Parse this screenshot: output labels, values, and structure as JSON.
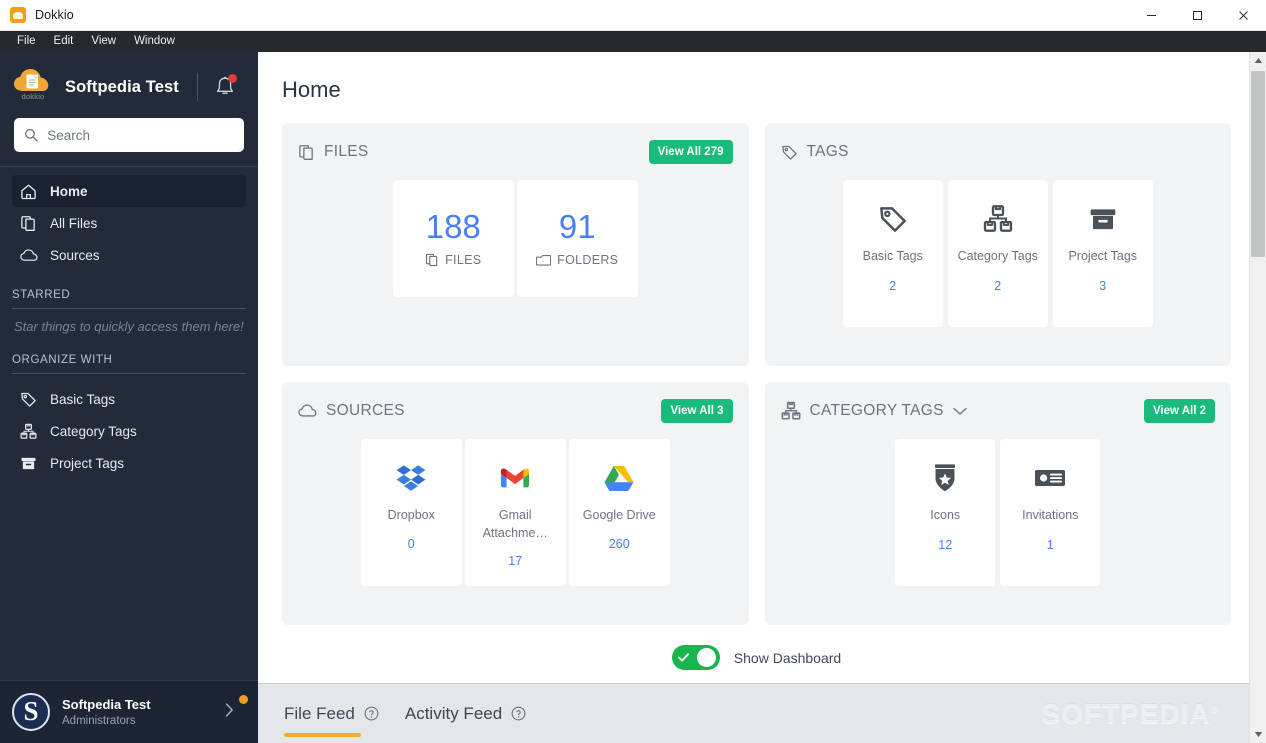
{
  "window": {
    "title": "Dokkio",
    "app_icon": "dokkio-cloud-icon",
    "controls": {
      "minimize": "minimize-icon",
      "maximize": "maximize-icon",
      "close": "close-icon"
    }
  },
  "menubar": {
    "items": [
      "File",
      "Edit",
      "View",
      "Window"
    ]
  },
  "sidebar": {
    "logo_text": "dokkio",
    "account_name": "Softpedia Test",
    "bell": {
      "icon": "bell-icon",
      "has_notification": true
    },
    "search": {
      "placeholder": "Search",
      "value": ""
    },
    "nav": [
      {
        "label": "Home",
        "icon": "home-icon",
        "active": true
      },
      {
        "label": "All Files",
        "icon": "files-icon",
        "active": false
      },
      {
        "label": "Sources",
        "icon": "cloud-icon",
        "active": false
      }
    ],
    "starred": {
      "heading": "STARRED",
      "empty_text": "Star things to quickly access them here!"
    },
    "organize": {
      "heading": "ORGANIZE WITH",
      "items": [
        {
          "label": "Basic Tags",
          "icon": "tag-icon"
        },
        {
          "label": "Category Tags",
          "icon": "category-tags-icon"
        },
        {
          "label": "Project Tags",
          "icon": "archive-box-icon"
        }
      ]
    },
    "user": {
      "avatar_letter": "S",
      "name": "Softpedia Test",
      "role": "Administrators",
      "chevron": "chevron-right-icon",
      "status_dot": true
    }
  },
  "main": {
    "page_title": "Home",
    "cards": {
      "files": {
        "title": "FILES",
        "icon": "files-icon",
        "view_all_label": "View All 279",
        "tiles": [
          {
            "value": "188",
            "label": "FILES",
            "icon": "files-icon"
          },
          {
            "value": "91",
            "label": "FOLDERS",
            "icon": "folder-icon"
          }
        ]
      },
      "tags": {
        "title": "TAGS",
        "icon": "tag-icon",
        "tiles": [
          {
            "name": "Basic Tags",
            "count": "2",
            "icon": "tag-icon"
          },
          {
            "name": "Category Tags",
            "count": "2",
            "icon": "category-tags-icon"
          },
          {
            "name": "Project Tags",
            "count": "3",
            "icon": "archive-box-icon"
          }
        ]
      },
      "sources": {
        "title": "SOURCES",
        "icon": "cloud-icon",
        "view_all_label": "View All 3",
        "tiles": [
          {
            "name": "Dropbox",
            "count": "0",
            "icon": "dropbox-icon"
          },
          {
            "name": "Gmail Attachme…",
            "count": "17",
            "icon": "gmail-icon"
          },
          {
            "name": "Google Drive",
            "count": "260",
            "icon": "google-drive-icon"
          }
        ]
      },
      "category_tags": {
        "title": "CATEGORY TAGS",
        "icon": "category-tags-icon",
        "chevron": "chevron-down-icon",
        "view_all_label": "View All 2",
        "tiles": [
          {
            "name": "Icons",
            "count": "12",
            "icon": "shield-star-icon"
          },
          {
            "name": "Invitations",
            "count": "1",
            "icon": "id-card-icon"
          }
        ]
      }
    },
    "dashboard_toggle": {
      "label": "Show Dashboard",
      "checked": true
    }
  },
  "feedbar": {
    "tabs": [
      {
        "label": "File Feed",
        "help_icon": "help-circle-icon",
        "active": true
      },
      {
        "label": "Activity Feed",
        "help_icon": "help-circle-icon",
        "active": false
      }
    ],
    "watermark": "SOFTPEDIA"
  },
  "colors": {
    "sidebar_bg": "#232b3b",
    "accent_green": "#18bb7b",
    "accent_blue": "#4a7ef5",
    "accent_orange": "#f0a01e",
    "toggle_green": "#17b54e",
    "card_bg": "#f2f3f5"
  }
}
